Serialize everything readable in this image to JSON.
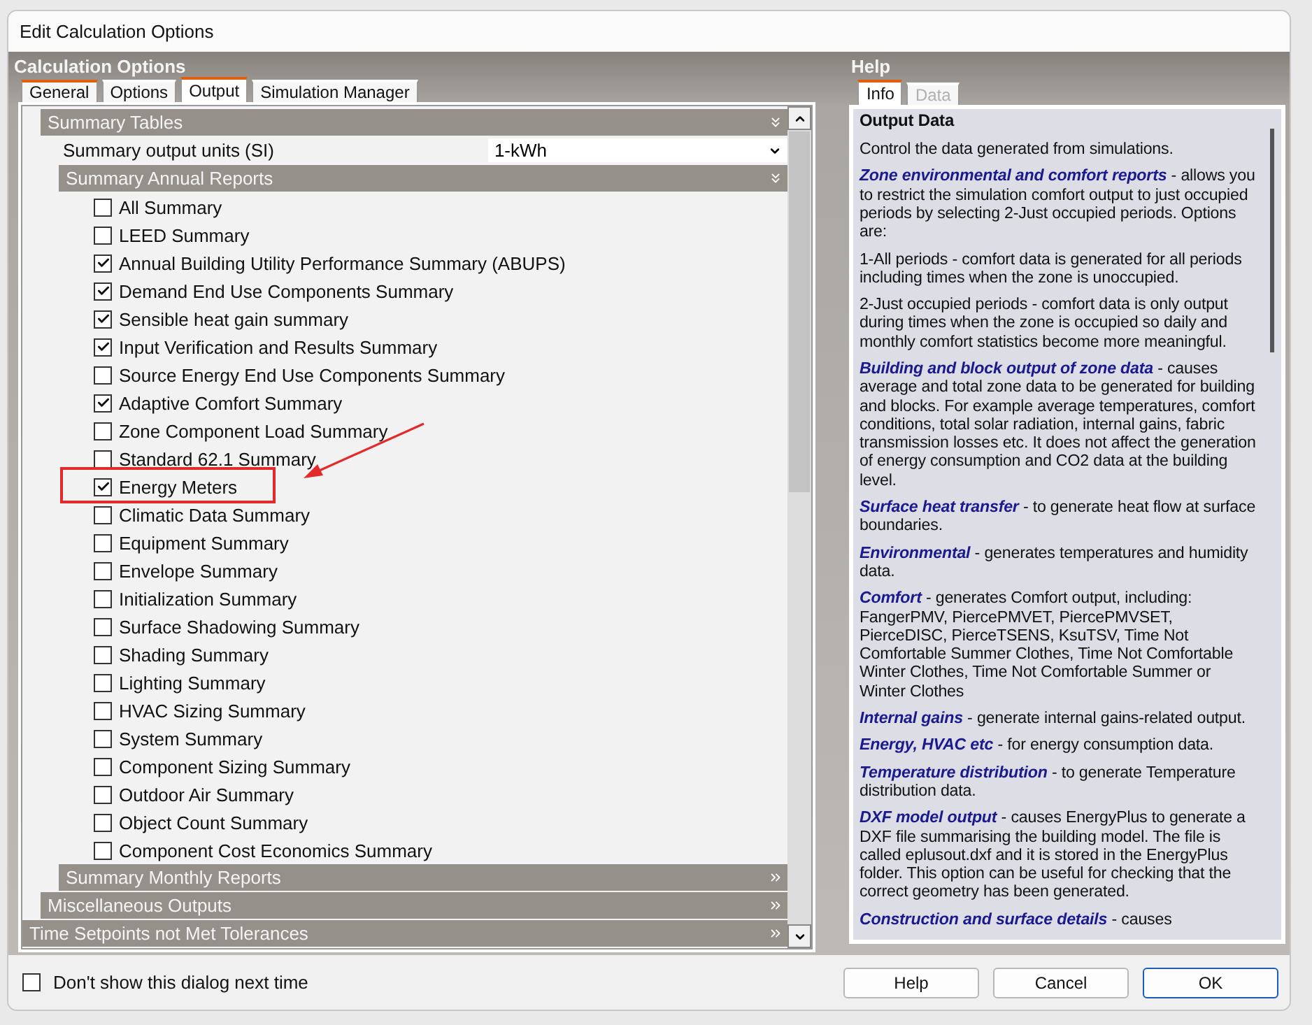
{
  "window": {
    "title": "Edit Calculation Options"
  },
  "left_panel": {
    "title": "Calculation Options",
    "tabs": [
      {
        "label": "General",
        "selected": false,
        "flagged": true
      },
      {
        "label": "Options",
        "selected": false,
        "flagged": false
      },
      {
        "label": "Output",
        "selected": true,
        "flagged": true
      },
      {
        "label": "Simulation Manager",
        "selected": false,
        "flagged": false
      }
    ],
    "outline": [
      {
        "kind": "group",
        "children": [
          {
            "kind": "section",
            "title": "Summary Tables",
            "expanded": true,
            "children": [
              {
                "kind": "dropdown",
                "label": "Summary output units (SI)",
                "value": "1-kWh"
              },
              {
                "kind": "section",
                "title": "Summary Annual Reports",
                "expanded": true,
                "children": [
                  {
                    "kind": "checkbox",
                    "label": "All Summary",
                    "checked": false,
                    "highlighted": false
                  },
                  {
                    "kind": "checkbox",
                    "label": "LEED Summary",
                    "checked": false,
                    "highlighted": false
                  },
                  {
                    "kind": "checkbox",
                    "label": "Annual Building Utility Performance Summary (ABUPS)",
                    "checked": true,
                    "highlighted": false
                  },
                  {
                    "kind": "checkbox",
                    "label": "Demand End Use Components Summary",
                    "checked": true,
                    "highlighted": false
                  },
                  {
                    "kind": "checkbox",
                    "label": "Sensible heat gain summary",
                    "checked": true,
                    "highlighted": false
                  },
                  {
                    "kind": "checkbox",
                    "label": "Input Verification and Results Summary",
                    "checked": true,
                    "highlighted": false
                  },
                  {
                    "kind": "checkbox",
                    "label": "Source Energy End Use Components Summary",
                    "checked": false,
                    "highlighted": false
                  },
                  {
                    "kind": "checkbox",
                    "label": "Adaptive Comfort Summary",
                    "checked": true,
                    "highlighted": false
                  },
                  {
                    "kind": "checkbox",
                    "label": "Zone Component Load Summary",
                    "checked": false,
                    "highlighted": false
                  },
                  {
                    "kind": "checkbox",
                    "label": "Standard 62.1 Summary",
                    "checked": false,
                    "highlighted": false
                  },
                  {
                    "kind": "checkbox",
                    "label": "Energy Meters",
                    "checked": true,
                    "highlighted": true
                  },
                  {
                    "kind": "checkbox",
                    "label": "Climatic Data Summary",
                    "checked": false,
                    "highlighted": false
                  },
                  {
                    "kind": "checkbox",
                    "label": "Equipment Summary",
                    "checked": false,
                    "highlighted": false
                  },
                  {
                    "kind": "checkbox",
                    "label": "Envelope Summary",
                    "checked": false,
                    "highlighted": false
                  },
                  {
                    "kind": "checkbox",
                    "label": "Initialization Summary",
                    "checked": false,
                    "highlighted": false
                  },
                  {
                    "kind": "checkbox",
                    "label": "Surface Shadowing Summary",
                    "checked": false,
                    "highlighted": false
                  },
                  {
                    "kind": "checkbox",
                    "label": "Shading Summary",
                    "checked": false,
                    "highlighted": false
                  },
                  {
                    "kind": "checkbox",
                    "label": "Lighting Summary",
                    "checked": false,
                    "highlighted": false
                  },
                  {
                    "kind": "checkbox",
                    "label": "HVAC Sizing Summary",
                    "checked": false,
                    "highlighted": false
                  },
                  {
                    "kind": "checkbox",
                    "label": "System Summary",
                    "checked": false,
                    "highlighted": false
                  },
                  {
                    "kind": "checkbox",
                    "label": "Component Sizing Summary",
                    "checked": false,
                    "highlighted": false
                  },
                  {
                    "kind": "checkbox",
                    "label": "Outdoor Air Summary",
                    "checked": false,
                    "highlighted": false
                  },
                  {
                    "kind": "checkbox",
                    "label": "Object Count Summary",
                    "checked": false,
                    "highlighted": false
                  },
                  {
                    "kind": "checkbox",
                    "label": "Component Cost Economics Summary",
                    "checked": false,
                    "highlighted": false
                  }
                ]
              },
              {
                "kind": "section",
                "title": "Summary Monthly Reports",
                "expanded": false
              }
            ]
          },
          {
            "kind": "section",
            "title": "Miscellaneous Outputs",
            "expanded": false
          }
        ]
      },
      {
        "kind": "section",
        "title": "Time Setpoints not Met Tolerances",
        "expanded": false
      }
    ]
  },
  "help_panel": {
    "title": "Help",
    "tabs": [
      {
        "label": "Info",
        "selected": true,
        "disabled": false
      },
      {
        "label": "Data",
        "selected": false,
        "disabled": true
      }
    ],
    "heading": "Output Data",
    "paragraphs": [
      {
        "text": "Control the data generated from simulations."
      },
      {
        "term": "Zone environmental and comfort reports",
        "text": " - allows you to restrict the simulation comfort output to just occupied periods by selecting 2-Just occupied periods. Options are:"
      },
      {
        "text": "1-All periods - comfort data is generated for all periods including times when the zone is unoccupied."
      },
      {
        "text": "2-Just occupied periods - comfort data is only output during times when the zone is occupied so daily and monthly comfort statistics become more meaningful."
      },
      {
        "term": "Building and block output of zone data",
        "text": " - causes average and total zone data to be generated for building and blocks. For example average temperatures, comfort conditions, total solar radiation, internal gains, fabric transmission losses etc. It does not affect the generation of energy consumption and CO2 data at the building level."
      },
      {
        "term": "Surface heat transfer",
        "text": " - to generate heat flow at surface boundaries."
      },
      {
        "term": "Environmental",
        "text": " - generates temperatures and humidity data."
      },
      {
        "term": "Comfort",
        "text": " - generates Comfort output, including: FangerPMV, PiercePMVET, PiercePMVSET, PierceDISC, PierceTSENS, KsuTSV, Time Not Comfortable Summer Clothes, Time Not Comfortable Winter Clothes, Time Not Comfortable Summer or Winter Clothes"
      },
      {
        "term": "Internal gains",
        "text": " - generate internal gains-related output."
      },
      {
        "term": "Energy, HVAC etc",
        "text": " - for energy consumption data."
      },
      {
        "term": "Temperature distribution",
        "text": " - to generate Temperature distribution data."
      },
      {
        "term": "DXF model output",
        "text": " - causes EnergyPlus to generate a DXF file summarising the building model. The file is called eplusout.dxf and it is stored in the EnergyPlus folder. This option can be useful for checking that the correct geometry has been generated."
      },
      {
        "term": "Construction and surface details",
        "text": " - causes"
      }
    ]
  },
  "footer": {
    "dont_show": {
      "label": "Don't show this dialog next time",
      "checked": false
    },
    "buttons": [
      {
        "label": "Help",
        "default": false
      },
      {
        "label": "Cancel",
        "default": false
      },
      {
        "label": "OK",
        "default": true
      }
    ]
  }
}
